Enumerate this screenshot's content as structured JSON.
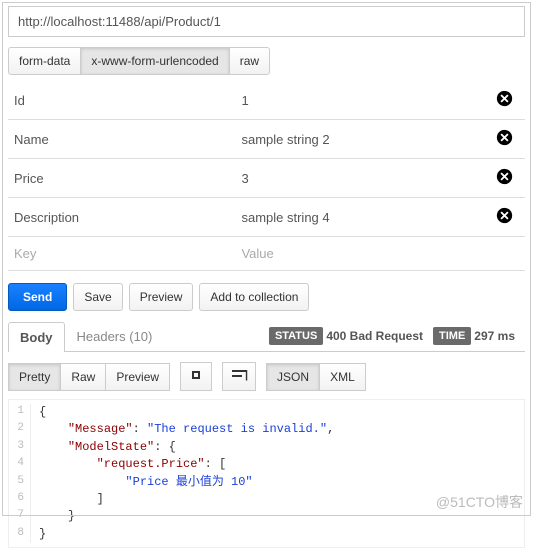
{
  "url": "http://localhost:11488/api/Product/1",
  "body_types": [
    "form-data",
    "x-www-form-urlencoded",
    "raw"
  ],
  "body_type_active": 1,
  "params": [
    {
      "key": "Id",
      "value": "1"
    },
    {
      "key": "Name",
      "value": "sample string 2"
    },
    {
      "key": "Price",
      "value": "3"
    },
    {
      "key": "Description",
      "value": "sample string 4"
    }
  ],
  "param_placeholder": {
    "key": "Key",
    "value": "Value"
  },
  "actions": {
    "send": "Send",
    "save": "Save",
    "preview": "Preview",
    "add": "Add to collection"
  },
  "response": {
    "tabs": {
      "body": "Body",
      "headers": "Headers (10)"
    },
    "status_label": "STATUS",
    "status_value": "400 Bad Request",
    "time_label": "TIME",
    "time_value": "297 ms",
    "view_modes": {
      "pretty": "Pretty",
      "raw": "Raw",
      "preview": "Preview"
    },
    "formats": {
      "json": "JSON",
      "xml": "XML"
    },
    "json": {
      "Message": "The request is invalid.",
      "ModelState": {
        "request.Price": [
          "Price 最小值为 10"
        ]
      }
    }
  },
  "watermark": "@51CTO博客"
}
